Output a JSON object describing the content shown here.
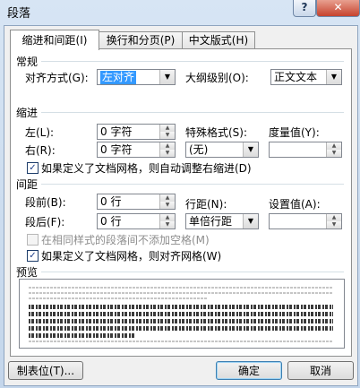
{
  "window": {
    "title": "段落",
    "help_label": "?",
    "close_label": "✕"
  },
  "tabs": [
    {
      "label": "缩进和间距(I)"
    },
    {
      "label": "换行和分页(P)"
    },
    {
      "label": "中文版式(H)"
    }
  ],
  "general": {
    "section_label": "常规",
    "align_label": "对齐方式(G):",
    "align_value": "左对齐",
    "outline_label": "大纲级别(O):",
    "outline_value": "正文文本"
  },
  "indent": {
    "section_label": "缩进",
    "left_label": "左(L):",
    "left_value": "0 字符",
    "right_label": "右(R):",
    "right_value": "0 字符",
    "special_label": "特殊格式(S):",
    "special_value": "(无)",
    "measure_label": "度量值(Y):",
    "measure_value": "",
    "auto_adjust_label": "如果定义了文档网格，则自动调整右缩进(D)",
    "auto_adjust_checked": true
  },
  "spacing": {
    "section_label": "间距",
    "before_label": "段前(B):",
    "before_value": "0 行",
    "after_label": "段后(F):",
    "after_value": "0 行",
    "line_label": "行距(N):",
    "line_value": "单倍行距",
    "setting_label": "设置值(A):",
    "setting_value": "",
    "no_space_label": "在相同样式的段落间不添加空格(M)",
    "no_space_checked": false,
    "grid_align_label": "如果定义了文档网格，则对齐网格(W)",
    "grid_align_checked": true
  },
  "preview": {
    "section_label": "预览"
  },
  "footer": {
    "tabs_button": "制表位(T)...",
    "ok_button": "确定",
    "cancel_button": "取消"
  },
  "check_mark": "✓",
  "colors": {
    "selection": "#3399ff",
    "close_button": "#c6422d",
    "frame": "#c9d9ec"
  }
}
